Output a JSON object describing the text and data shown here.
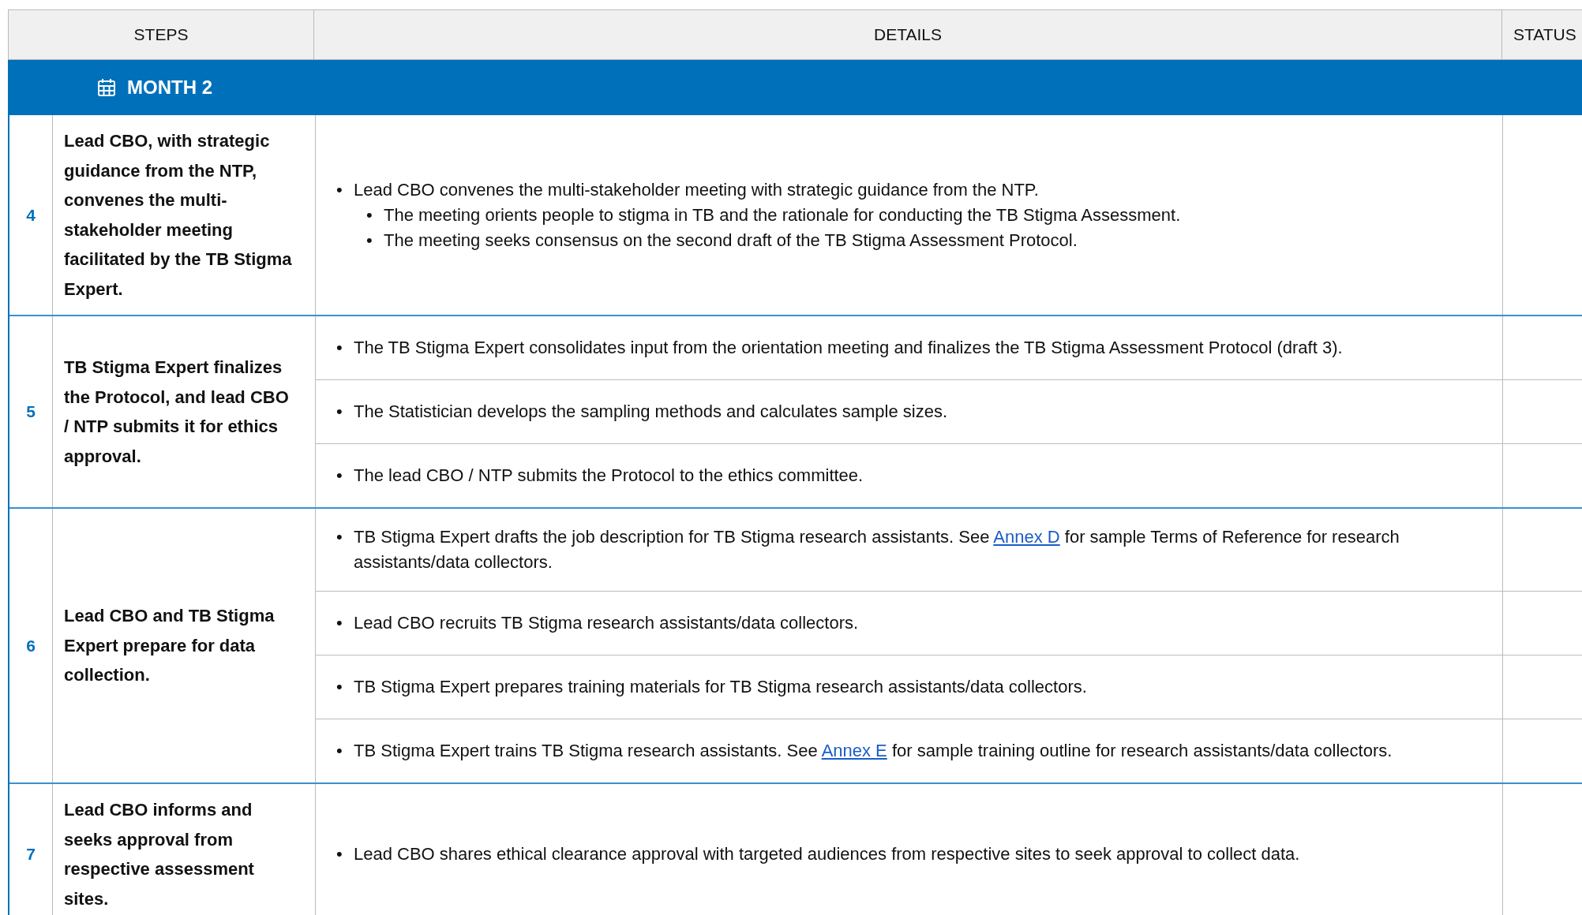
{
  "table": {
    "columns": [
      "STEPS",
      "DETAILS",
      "STATUS"
    ],
    "section": {
      "title": "MONTH 2"
    },
    "rows": [
      {
        "number": "4",
        "step": "Lead CBO, with strategic guidance from the NTP, convenes the multi-stakeholder meeting facilitated by the TB Stigma Expert.",
        "details": [
          {
            "items": [
              {
                "bullet": "•",
                "text": "Lead CBO convenes the multi-stakeholder meeting with strategic guidance from the NTP.",
                "children": [
                  {
                    "bullet": "•",
                    "text": "The meeting orients people to stigma in TB and the rationale for conducting the TB Stigma Assessment."
                  },
                  {
                    "bullet": "•",
                    "text": "The meeting seeks consensus on the second draft of the TB Stigma Assessment Protocol."
                  }
                ]
              }
            ]
          }
        ]
      },
      {
        "number": "5",
        "step": "TB Stigma Expert finalizes the Protocol, and lead CBO / NTP submits it for ethics approval.",
        "details": [
          {
            "items": [
              {
                "bullet": "•",
                "text": "The TB Stigma Expert consolidates input from the orientation meeting and finalizes the TB Stigma Assessment Protocol (draft 3)."
              }
            ]
          },
          {
            "items": [
              {
                "bullet": "•",
                "text": "The Statistician develops the sampling methods and calculates sample sizes."
              }
            ]
          },
          {
            "items": [
              {
                "bullet": "•",
                "text": "The lead CBO / NTP submits the Protocol to the ethics committee."
              }
            ]
          }
        ]
      },
      {
        "number": "6",
        "step": "Lead CBO and TB Stigma Expert prepare for data collection.",
        "details": [
          {
            "items": [
              {
                "bullet": "•",
                "text": "TB Stigma Expert drafts the job description for TB Stigma research assistants. See",
                "link": "Annex D",
                "after": "for sample Terms of Reference for research assistants/data collectors."
              }
            ]
          },
          {
            "items": [
              {
                "bullet": "•",
                "text": "Lead CBO recruits TB Stigma research assistants/data collectors."
              }
            ]
          },
          {
            "items": [
              {
                "bullet": "•",
                "text": "TB Stigma Expert prepares training materials for TB Stigma research assistants/data collectors."
              }
            ]
          },
          {
            "items": [
              {
                "bullet": "•",
                "text": "TB Stigma Expert trains TB Stigma research assistants. See",
                "link": "Annex E",
                "after": "for sample training outline for research assistants/data collectors."
              }
            ]
          }
        ]
      },
      {
        "number": "7",
        "step": "Lead CBO informs and seeks approval from respective assessment sites.",
        "details": [
          {
            "items": [
              {
                "bullet": "•",
                "text": "Lead CBO shares ethical clearance approval with targeted audiences from respective sites to seek approval to collect data."
              }
            ]
          }
        ]
      }
    ]
  }
}
